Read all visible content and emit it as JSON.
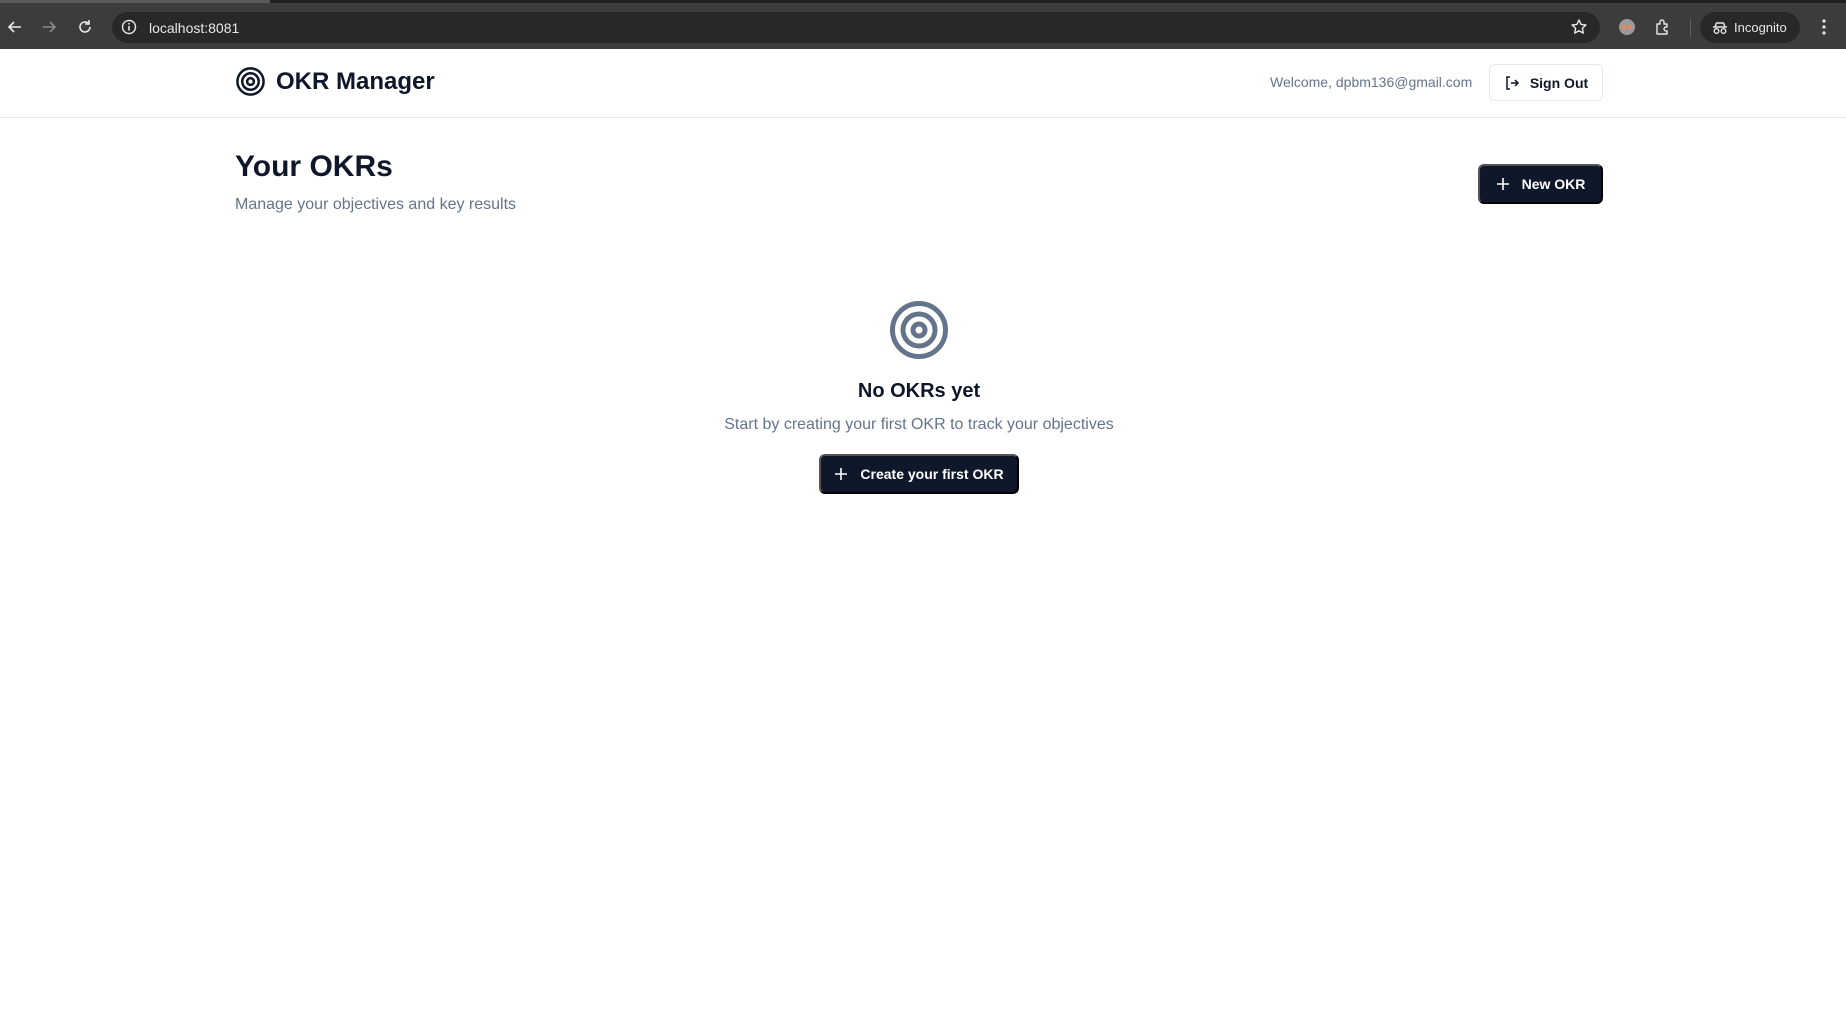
{
  "browser": {
    "url": "localhost:8081",
    "profile_label": "Incognito"
  },
  "header": {
    "brand_title": "OKR Manager",
    "welcome_text": "Welcome, dpbm136@gmail.com",
    "sign_out_label": "Sign Out"
  },
  "page": {
    "title": "Your OKRs",
    "subtitle": "Manage your objectives and key results",
    "new_button_label": "New OKR"
  },
  "empty_state": {
    "title": "No OKRs yet",
    "description": "Start by creating your first OKR to track your objectives",
    "button_label": "Create your first OKR"
  },
  "colors": {
    "primary": "#0f172a",
    "muted_text": "#64748b",
    "empty_icon": "#64748b",
    "chrome_bg": "#3c3c3c"
  },
  "icons": {
    "brand": "target-icon",
    "empty": "target-icon",
    "sign_out": "log-out-icon",
    "add": "plus-icon"
  }
}
